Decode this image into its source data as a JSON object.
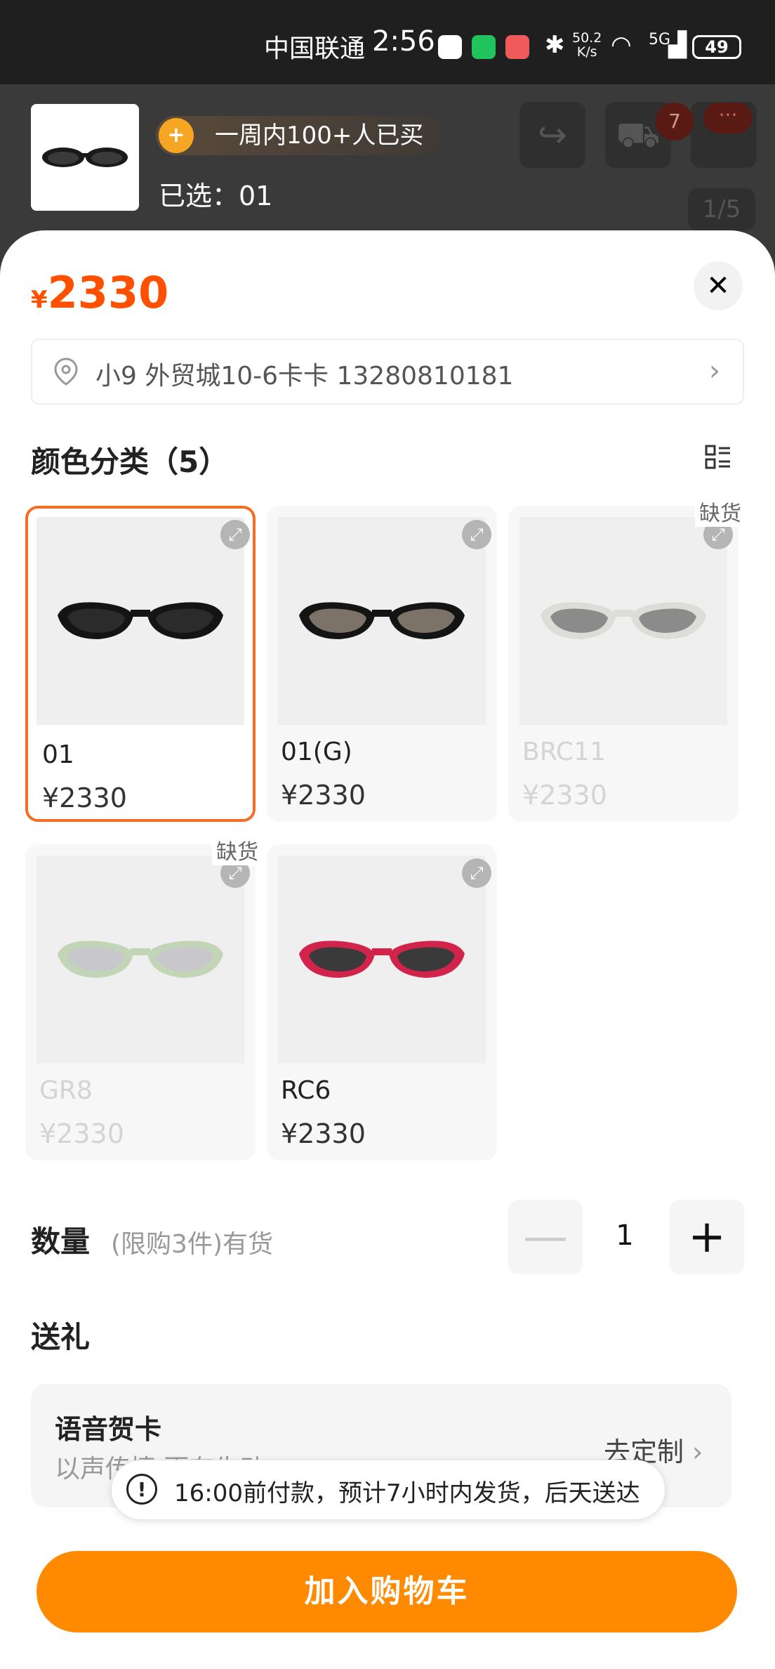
{
  "status_bar": {
    "carrier": "中国联通",
    "time": "2:56",
    "net_speed_value": "50.2",
    "net_speed_unit": "K/s",
    "network": "5G",
    "battery": "49"
  },
  "header": {
    "hot_badge": "一周内100+人已买",
    "selected_label": "已选：01",
    "cart_count": "7",
    "more_label": "···",
    "page_indicator": "1/5"
  },
  "sheet": {
    "currency": "¥",
    "price": "2330",
    "close_label": "✕",
    "address": "小9 外贸城10-6卡卡 13280810181",
    "color_section_title": "颜色分类（5）",
    "out_of_stock_label": "缺货",
    "variants": [
      {
        "name": "01",
        "price": "¥2330",
        "selected": true,
        "out_of_stock": false,
        "frame_color": "#141414",
        "lens_color": "#2b2b2b"
      },
      {
        "name": "01(G)",
        "price": "¥2330",
        "selected": false,
        "out_of_stock": false,
        "frame_color": "#141414",
        "lens_color": "#7c7268"
      },
      {
        "name": "BRC11",
        "price": "¥2330",
        "selected": false,
        "out_of_stock": true,
        "frame_color": "#cfcfc4",
        "lens_color": "#3a3a3a"
      },
      {
        "name": "GR8",
        "price": "¥2330",
        "selected": false,
        "out_of_stock": true,
        "frame_color": "#9fc187",
        "lens_color": "#a9a9b0"
      },
      {
        "name": "RC6",
        "price": "¥2330",
        "selected": false,
        "out_of_stock": false,
        "frame_color": "#d2234a",
        "lens_color": "#3a3a3a"
      }
    ],
    "quantity": {
      "label": "数量",
      "note": "(限购3件)有货",
      "value": "1",
      "minus": "—",
      "plus": "+"
    },
    "gift": {
      "title": "送礼",
      "card_name": "语音贺卡",
      "card_sub": "以声传情 更有生动",
      "action": "去定制"
    },
    "toast": {
      "icon": "!",
      "text": "16:00前付款，预计7小时内发货，后天送达"
    },
    "cta": "加入购物车"
  },
  "colors": {
    "accent": "#ff5000",
    "cta": "#ff8a00",
    "selected_border": "#f36e20"
  }
}
